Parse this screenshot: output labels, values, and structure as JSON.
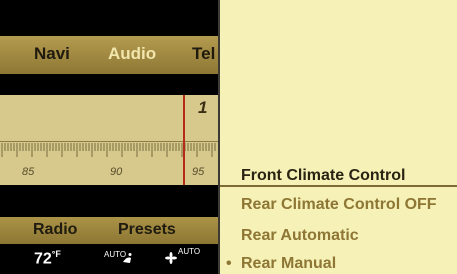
{
  "nav": {
    "items": [
      "Navi",
      "Audio",
      "Tel"
    ],
    "active": "Audio"
  },
  "radio": {
    "frequency_partial": "1",
    "scale_labels": [
      "85",
      "90",
      "95"
    ]
  },
  "bottom_menu": {
    "radio_label": "Radio",
    "presets_label": "Presets"
  },
  "status_bar": {
    "temperature": "72",
    "temperature_unit": "°F",
    "auto_label_1": "AUTO",
    "auto_label_2": "AUTO",
    "icons": [
      "seat-heat-icon",
      "fan-icon"
    ]
  },
  "climate_menu": {
    "items": [
      "Front Climate Control",
      "Rear Climate Control OFF",
      "Rear Automatic",
      "Rear Manual"
    ],
    "selected_marker": "•",
    "selected_index": 3,
    "highlighted_index": 0
  },
  "colors": {
    "menu_background": "#f5f1b7",
    "menu_text_inactive": "#8e7634",
    "menu_text_active": "#2a2313",
    "tab_bar": "#a38b3e",
    "active_tab_text": "#f1e6ad",
    "needle": "#b52a1a"
  }
}
